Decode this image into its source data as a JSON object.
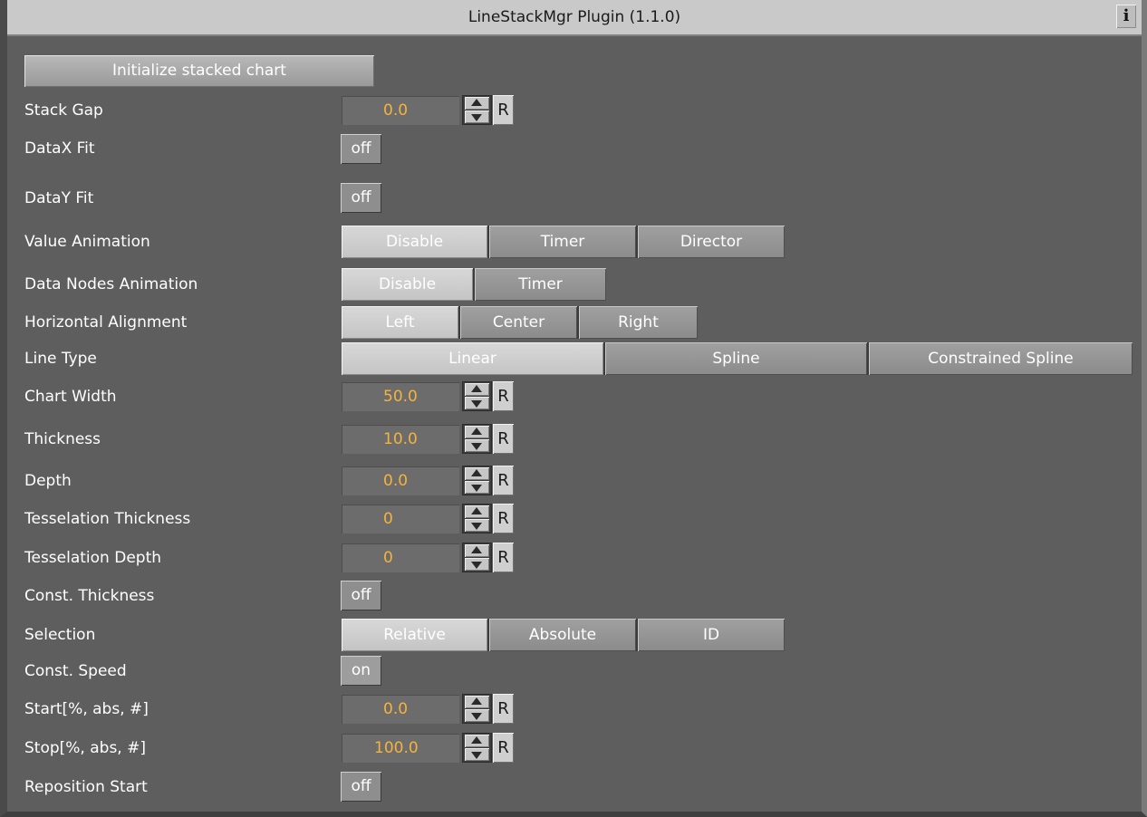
{
  "title": "LineStackMgr Plugin (1.1.0)",
  "info_label": "i",
  "init_button": "Initialize stacked chart",
  "stack_gap": {
    "label": "Stack Gap",
    "value": "0.0"
  },
  "datax_fit": {
    "label": "DataX Fit",
    "value": "off"
  },
  "datay_fit": {
    "label": "DataY Fit",
    "value": "off"
  },
  "value_animation": {
    "label": "Value Animation",
    "options": [
      "Disable",
      "Timer",
      "Director"
    ],
    "selected": "Disable"
  },
  "data_nodes_animation": {
    "label": "Data Nodes Animation",
    "options": [
      "Disable",
      "Timer"
    ],
    "selected": "Disable"
  },
  "horizontal_alignment": {
    "label": "Horizontal Alignment",
    "options": [
      "Left",
      "Center",
      "Right"
    ],
    "selected": "Left"
  },
  "line_type": {
    "label": "Line Type",
    "options": [
      "Linear",
      "Spline",
      "Constrained Spline"
    ],
    "selected": "Linear"
  },
  "chart_width": {
    "label": "Chart Width",
    "value": "50.0"
  },
  "thickness": {
    "label": "Thickness",
    "value": "10.0"
  },
  "depth": {
    "label": "Depth",
    "value": "0.0"
  },
  "tesselation_thickness": {
    "label": "Tesselation Thickness",
    "value": "0"
  },
  "tesselation_depth": {
    "label": "Tesselation Depth",
    "value": "0"
  },
  "const_thickness": {
    "label": "Const. Thickness",
    "value": "off"
  },
  "selection": {
    "label": "Selection",
    "options": [
      "Relative",
      "Absolute",
      "ID"
    ],
    "selected": "Relative"
  },
  "const_speed": {
    "label": "Const. Speed",
    "value": "on"
  },
  "start": {
    "label": "Start[%, abs, #]",
    "value": "0.0"
  },
  "stop": {
    "label": "Stop[%, abs, #]",
    "value": "100.0"
  },
  "reposition_start": {
    "label": "Reposition Start",
    "value": "off"
  },
  "reset_label": "R",
  "colors": {
    "background": "#5e5e5e",
    "titlebar": "#c9c9c9",
    "value_text": "#f5b33c"
  }
}
